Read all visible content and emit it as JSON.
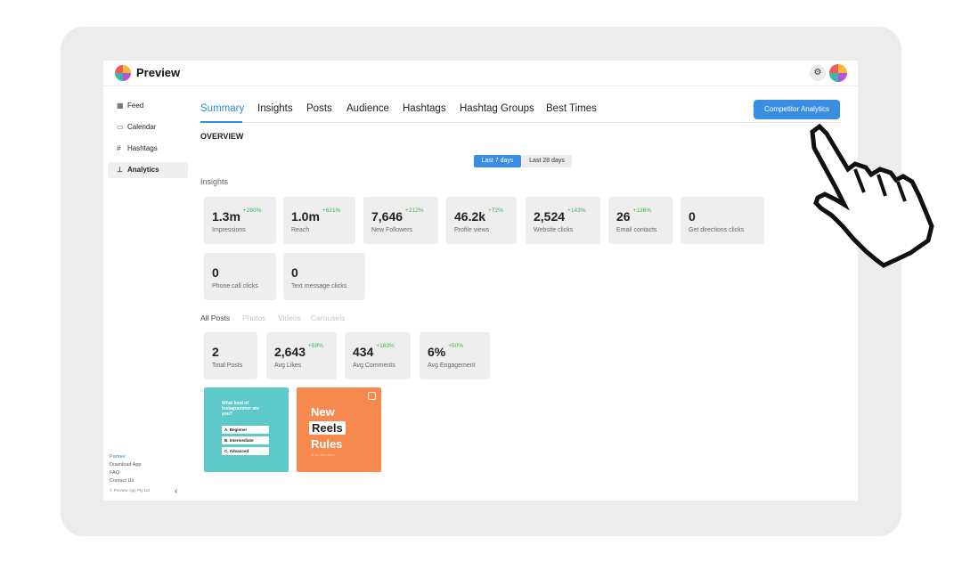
{
  "app": {
    "name": "Preview"
  },
  "sidebar": {
    "items": [
      {
        "label": "Feed",
        "icon": "grid-icon"
      },
      {
        "label": "Calendar",
        "icon": "calendar-icon"
      },
      {
        "label": "Hashtags",
        "icon": "hashtag-icon"
      },
      {
        "label": "Analytics",
        "icon": "chart-icon",
        "active": true
      }
    ],
    "footer": {
      "partner": "Partner",
      "download": "Download App",
      "faq": "FAQ",
      "contact": "Contact Us",
      "copyright": "© Preview App Pty Ltd"
    }
  },
  "tabs": [
    "Summary",
    "Insights",
    "Posts",
    "Audience",
    "Hashtags",
    "Hashtag Groups",
    "Best Times"
  ],
  "active_tab": "Summary",
  "competitor_button": "Competitor Analytics",
  "overview_title": "OVERVIEW",
  "range": {
    "selected": "Last 7 days",
    "other": "Last 28 days"
  },
  "insights": {
    "title": "Insights",
    "cards": [
      {
        "value": "1.3m",
        "change": "+280%",
        "label": "Impressions"
      },
      {
        "value": "1.0m",
        "change": "+621%",
        "label": "Reach"
      },
      {
        "value": "7,646",
        "change": "+212%",
        "label": "New Followers"
      },
      {
        "value": "46.2k",
        "change": "+72%",
        "label": "Profile views"
      },
      {
        "value": "2,524",
        "change": "+143%",
        "label": "Website clicks"
      },
      {
        "value": "26",
        "change": "+136%",
        "label": "Email contacts"
      },
      {
        "value": "0",
        "change": "",
        "label": "Get directions clicks"
      },
      {
        "value": "0",
        "change": "",
        "label": "Phone call clicks"
      },
      {
        "value": "0",
        "change": "",
        "label": "Text message clicks"
      }
    ]
  },
  "posts": {
    "tabs": [
      "All Posts",
      "Photos",
      "Videos",
      "Carousels"
    ],
    "cards": [
      {
        "value": "2",
        "change": "",
        "label": "Total Posts"
      },
      {
        "value": "2,643",
        "change": "+59%",
        "label": "Avg Likes"
      },
      {
        "value": "434",
        "change": "+163%",
        "label": "Avg Comments"
      },
      {
        "value": "6%",
        "change": "+50%",
        "label": "Avg Engagement"
      }
    ]
  },
  "thumbnails": {
    "quiz": {
      "question": "What kind of Instagrammer are you?",
      "options": [
        "A. Beginner",
        "B. Intermediate",
        "C. Advanced"
      ]
    },
    "reels": {
      "line1": "New",
      "line2": "Reels",
      "line3": "Rules",
      "small": "In our new video!"
    }
  },
  "colors": {
    "accent": "#2f8ae0",
    "positive": "#3bb44a",
    "card_bg": "#eeeeee"
  }
}
